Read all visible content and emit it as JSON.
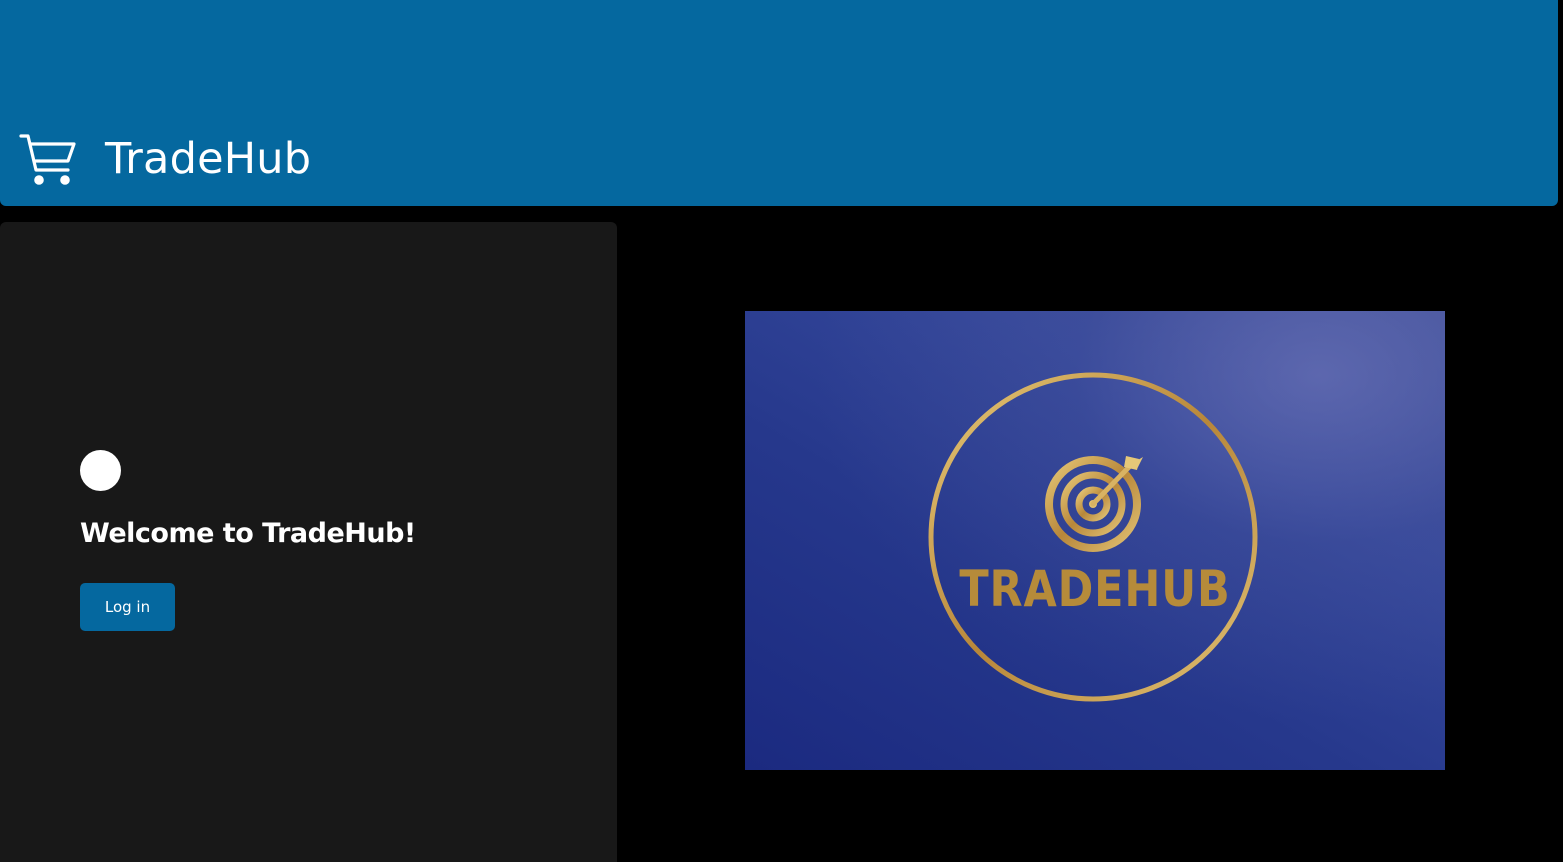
{
  "header": {
    "brand_icon": "cart-icon",
    "title": "TradeHub",
    "background_color": "#05689f"
  },
  "side_panel": {
    "avatar_icon": "avatar",
    "welcome_text": "Welcome to TradeHub!",
    "login_label": "Log in",
    "background_color": "#181818"
  },
  "logo": {
    "icon": "target-arrow-icon",
    "text": "TRADEHUB",
    "ring_color": "#c9a24f",
    "background_color": "#26388c"
  }
}
